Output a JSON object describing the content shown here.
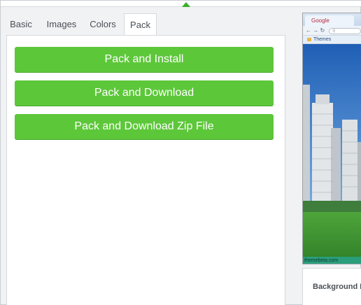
{
  "tabs": [
    {
      "label": "Basic"
    },
    {
      "label": "Images"
    },
    {
      "label": "Colors"
    },
    {
      "label": "Pack",
      "active": true
    }
  ],
  "actions": {
    "pack_install": "Pack and Install",
    "pack_download": "Pack and Download",
    "pack_download_zip": "Pack and Download Zip File"
  },
  "preview": {
    "tab_title": "Google",
    "omnibox_icon": "search-icon",
    "bookmark_folder": "Themes",
    "footer_text": "themebeta.com"
  },
  "settings": {
    "section_label": "Background I"
  },
  "colors": {
    "accent": "#5dc73a",
    "caret": "#3aae2a",
    "sky": "#2f76c7",
    "grass": "#3f9a2e"
  }
}
